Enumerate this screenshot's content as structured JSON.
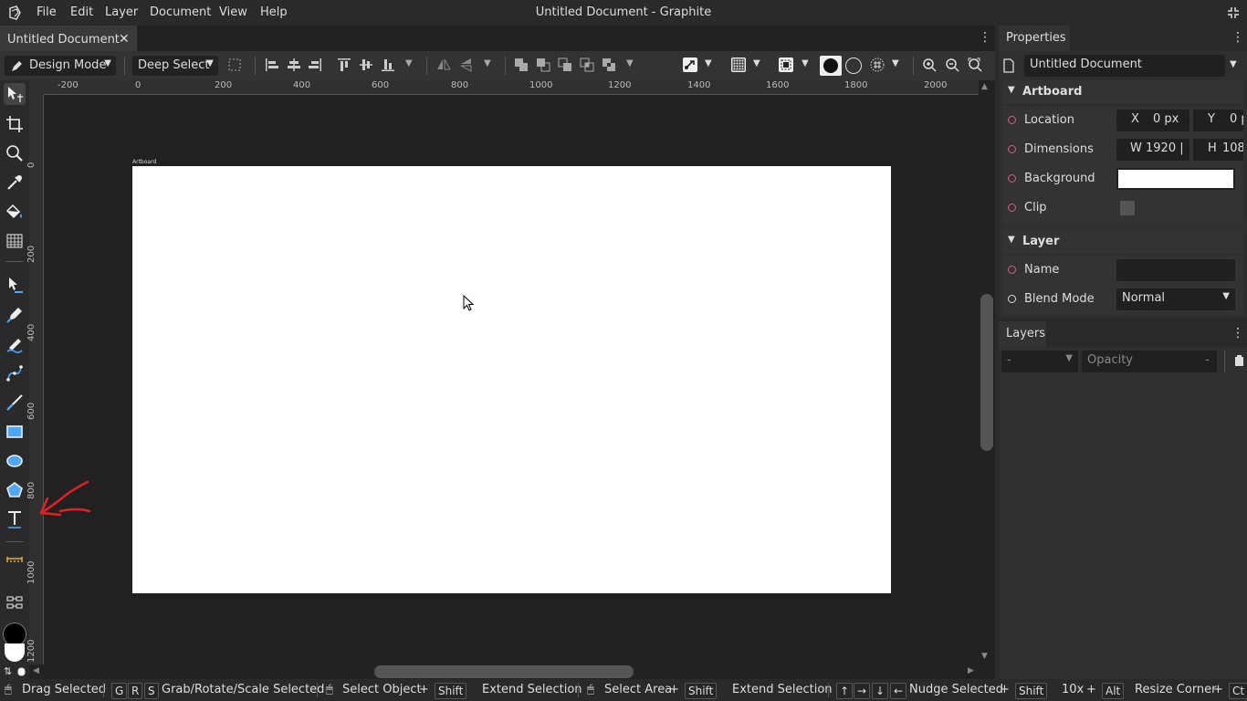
{
  "window": {
    "title": "Untitled Document - Graphite"
  },
  "menu": [
    "File",
    "Edit",
    "Layer",
    "Document",
    "View",
    "Help"
  ],
  "document_tab": {
    "label": "Untitled Document",
    "close": "✕"
  },
  "toolbar": {
    "mode": "Design Mode",
    "select": "Deep Select"
  },
  "rulers": {
    "top": [
      "-200",
      "0",
      "200",
      "400",
      "600",
      "800",
      "1000",
      "1200",
      "1400",
      "1600",
      "1800",
      "2000"
    ],
    "left": [
      "0",
      "200",
      "400",
      "600",
      "800",
      "1000",
      "1200"
    ]
  },
  "canvas": {
    "artboard_label": "Artboard",
    "artboard_color": "#ffffff"
  },
  "tools": [
    "select-tool-icon",
    "crop-tool-icon",
    "navigate-tool-icon",
    "eyedropper-tool-icon",
    "fill-tool-icon",
    "gradient-tool-icon",
    "path-tool-icon",
    "pen-tool-icon",
    "freehand-tool-icon",
    "spline-tool-icon",
    "line-tool-icon",
    "rectangle-tool-icon",
    "ellipse-tool-icon",
    "polygon-tool-icon",
    "text-tool-icon",
    "ruler-tool-icon",
    "node-graph-icon"
  ],
  "colors": {
    "primary": "#000000",
    "secondary": "#ffffff",
    "accent": "#e05a82"
  },
  "properties": {
    "tab": "Properties",
    "document_name": "Untitled Document",
    "artboard": {
      "header": "Artboard",
      "location_label": "Location",
      "x_label": "X",
      "x_value": "0 px",
      "y_label": "Y",
      "y_value": "0 p",
      "dimensions_label": "Dimensions",
      "w_label": "W",
      "w_value": "1920 |",
      "h_label": "H",
      "h_value": "1080",
      "background_label": "Background",
      "clip_label": "Clip"
    },
    "layer": {
      "header": "Layer",
      "name_label": "Name",
      "name_value": "",
      "blend_label": "Blend Mode",
      "blend_value": "Normal"
    }
  },
  "layers": {
    "tab": "Layers",
    "blend": "-",
    "opacity_label": "Opacity",
    "opacity_value": "-"
  },
  "status": {
    "drag": "Drag Selected",
    "grs_keys": [
      "G",
      "R",
      "S"
    ],
    "grs": "Grab/Rotate/Scale Selected",
    "select_object": "Select Object",
    "shift": "Shift",
    "extend": "Extend Selection",
    "select_area": "Select Area",
    "nudge": "Nudge Selected",
    "ten_x": "10x",
    "alt": "Alt",
    "resize": "Resize Corner",
    "ctrl": "Ct",
    "plus": "+"
  }
}
